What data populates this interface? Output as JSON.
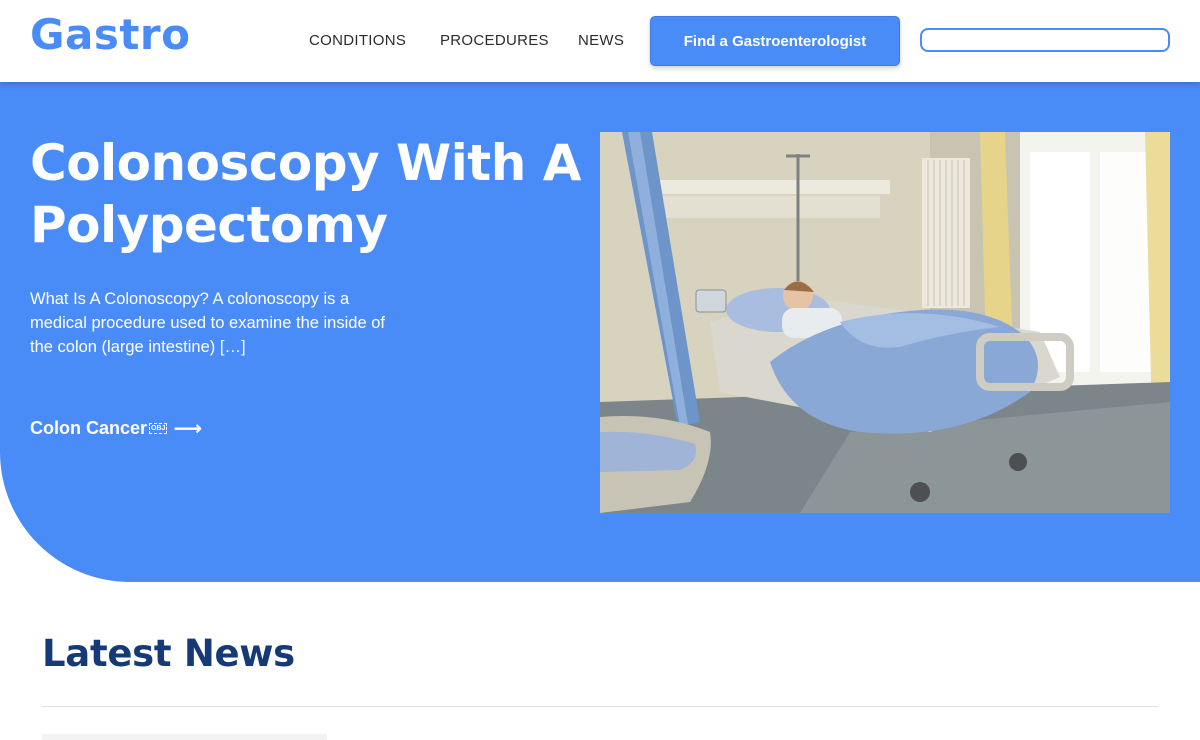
{
  "header": {
    "logo": "Gastro",
    "nav": [
      "CONDITIONS",
      "PROCEDURES",
      "NEWS"
    ],
    "cta_label": "Find a Gastroenterologist",
    "search_placeholder": ""
  },
  "hero": {
    "title": "Colonoscopy With A Polypectomy",
    "excerpt": "What Is A Colonoscopy? A colonoscopy is a medical procedure used to examine the inside of the colon (large intestine) […]",
    "category_label": "Colon Cancer",
    "category_glyph": "OBJ",
    "arrow_icon": "arrow-right-icon",
    "image_subject": "hospital-room-photo"
  },
  "latest": {
    "title": "Latest News"
  },
  "colors": {
    "accent": "#4a8cf7",
    "heading_dark": "#153a77",
    "nav_text": "#2b2b2b"
  }
}
